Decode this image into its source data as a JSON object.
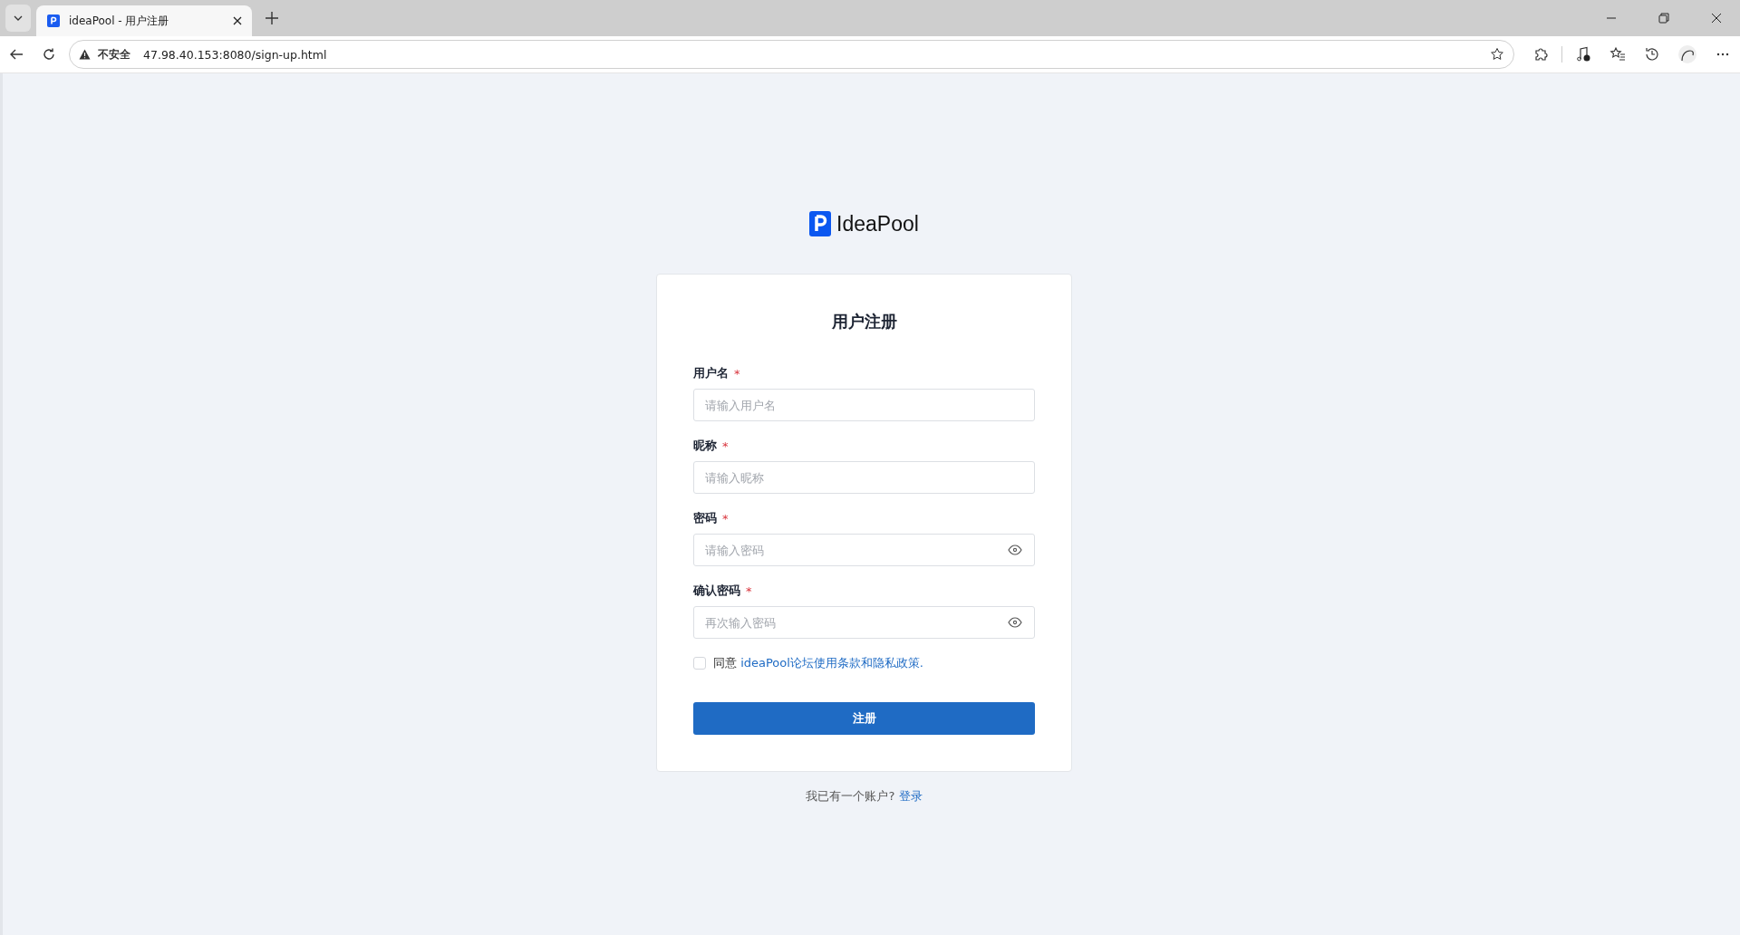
{
  "browser": {
    "tab": {
      "title": "ideaPool - 用户注册"
    },
    "address_bar": {
      "security": "不安全",
      "url": "47.98.40.153:8080/sign-up.html"
    }
  },
  "logo": {
    "text": "IdeaPool"
  },
  "form": {
    "title": "用户注册",
    "fields": [
      {
        "label": "用户名",
        "required": true,
        "required_mark": "*",
        "placeholder": "请输入用户名",
        "kind": "text"
      },
      {
        "label": "昵称",
        "required": true,
        "required_mark": "*",
        "placeholder": "请输入昵称",
        "kind": "text"
      },
      {
        "label": "密码",
        "required": true,
        "required_mark": "*",
        "placeholder": "请输入密码",
        "kind": "password"
      },
      {
        "label": "确认密码",
        "required": true,
        "required_mark": "*",
        "placeholder": "再次输入密码",
        "kind": "password"
      }
    ],
    "agreement": {
      "checked": false,
      "text": "同意",
      "link": "ideaPool论坛使用条款和隐私政策."
    },
    "submit": "注册"
  },
  "footer": {
    "text": "我已有一个账户?",
    "link": "登录"
  }
}
